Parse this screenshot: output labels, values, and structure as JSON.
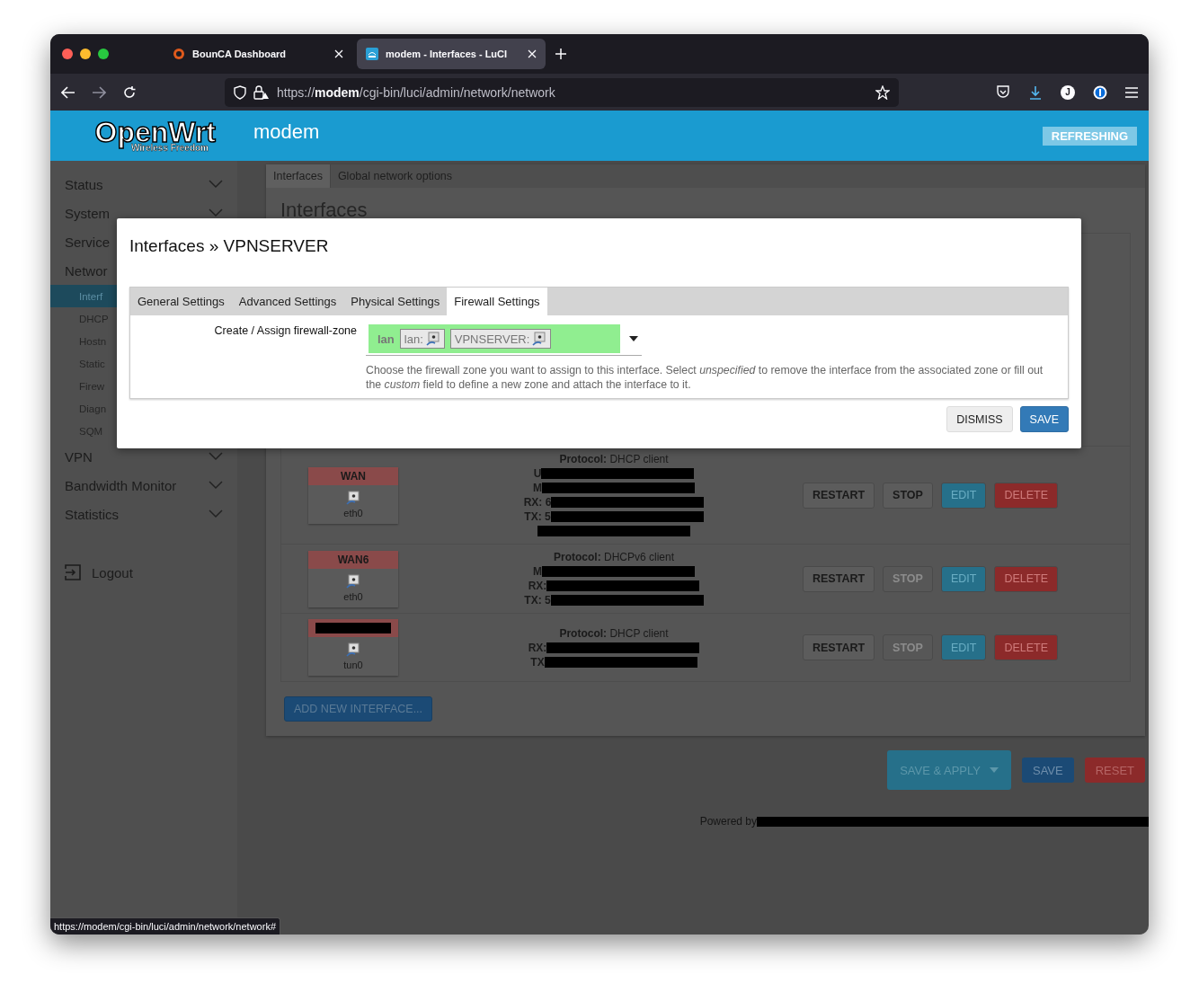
{
  "browser": {
    "tabs": [
      {
        "title": "BounCA Dashboard",
        "selected": false
      },
      {
        "title": "modem - Interfaces - LuCI",
        "selected": true
      }
    ],
    "url": {
      "scheme": "https://",
      "host": "modem",
      "path": "/cgi-bin/luci/admin/network/network"
    },
    "account_letter": "J"
  },
  "header": {
    "logo": "OpenWrt",
    "tagline": "Wireless Freedom",
    "hostname": "modem",
    "badge": "REFRESHING"
  },
  "sidebar": {
    "items": [
      {
        "label": "Status",
        "chevron": true
      },
      {
        "label": "System",
        "chevron": true
      },
      {
        "label": "Service"
      },
      {
        "label": "Networ",
        "children": [
          {
            "label": "Interf",
            "selected": true
          },
          {
            "label": "DHCP",
            "selected": false
          },
          {
            "label": "Hostn",
            "selected": false
          },
          {
            "label": "Static",
            "selected": false
          },
          {
            "label": "Firew",
            "selected": false
          },
          {
            "label": "Diagn",
            "selected": false
          },
          {
            "label": "SQM",
            "selected": false
          }
        ]
      },
      {
        "label": "VPN",
        "chevron": true
      },
      {
        "label": "Bandwidth Monitor",
        "chevron": true
      },
      {
        "label": "Statistics",
        "chevron": true
      }
    ],
    "logout": "Logout"
  },
  "content": {
    "tabs": [
      {
        "label": "Interfaces",
        "selected": true
      },
      {
        "label": "Global network options",
        "selected": false
      }
    ],
    "heading": "Interfaces",
    "interfaces": [
      {
        "name": "WAN",
        "name_redacted": false,
        "device": "eth0",
        "lines": [
          {
            "label": "Protocol:",
            "value": "DHCP client"
          },
          {
            "label": "U",
            "redacted": true
          },
          {
            "label": "M",
            "redacted": true
          },
          {
            "label": "RX: 6",
            "redacted": true
          },
          {
            "label": "TX: 5",
            "redacted": true
          },
          {
            "redacted": true
          }
        ],
        "buttons": [
          {
            "label": "RESTART",
            "kind": "restart",
            "disabled": false
          },
          {
            "label": "STOP",
            "kind": "stop",
            "disabled": false
          },
          {
            "label": "EDIT",
            "kind": "edit",
            "disabled": false
          },
          {
            "label": "DELETE",
            "kind": "delete",
            "disabled": false
          }
        ]
      },
      {
        "name": "WAN6",
        "name_redacted": false,
        "device": "eth0",
        "lines": [
          {
            "label": "Protocol:",
            "value": "DHCPv6 client"
          },
          {
            "label": "M",
            "redacted": true
          },
          {
            "label": "RX:",
            "redacted": true
          },
          {
            "label": "TX: 5",
            "redacted": true
          }
        ],
        "buttons": [
          {
            "label": "RESTART",
            "kind": "restart",
            "disabled": false
          },
          {
            "label": "STOP",
            "kind": "stop",
            "disabled": true
          },
          {
            "label": "EDIT",
            "kind": "edit",
            "disabled": false
          },
          {
            "label": "DELETE",
            "kind": "delete",
            "disabled": false
          }
        ]
      },
      {
        "name_redacted": true,
        "device": "tun0",
        "lines": [
          {
            "label": "Protocol:",
            "value": "DHCP client"
          },
          {
            "label": "RX:",
            "redacted": true
          },
          {
            "label": "TX",
            "redacted": true
          }
        ],
        "buttons": [
          {
            "label": "RESTART",
            "kind": "restart",
            "disabled": false
          },
          {
            "label": "STOP",
            "kind": "stop",
            "disabled": true
          },
          {
            "label": "EDIT",
            "kind": "edit",
            "disabled": false
          },
          {
            "label": "DELETE",
            "kind": "delete",
            "disabled": false
          }
        ]
      }
    ],
    "add_button": "ADD NEW INTERFACE...",
    "actions": [
      {
        "label": "SAVE & APPLY",
        "kind": "apply"
      },
      {
        "label": "SAVE",
        "kind": "save"
      },
      {
        "label": "RESET",
        "kind": "reset"
      }
    ],
    "powered_by": "Powered by"
  },
  "modal": {
    "title": "Interfaces » VPNSERVER",
    "tabs": [
      {
        "label": "General Settings",
        "selected": false
      },
      {
        "label": "Advanced Settings",
        "selected": false
      },
      {
        "label": "Physical Settings",
        "selected": false
      },
      {
        "label": "Firewall Settings",
        "selected": true
      }
    ],
    "field_label": "Create / Assign firewall-zone",
    "zone": {
      "name": "lan",
      "chips": [
        "lan:",
        "VPNSERVER:"
      ]
    },
    "description": "Choose the firewall zone you want to assign to this interface. Select *unspecified* to remove the interface from the associated zone or fill out the *custom* field to define a new zone and attach the interface to it.",
    "buttons": [
      {
        "label": "DISMISS",
        "kind": "dismiss"
      },
      {
        "label": "SAVE",
        "kind": "save"
      }
    ]
  },
  "status_url": "https://modem/cgi-bin/luci/admin/network/network#"
}
